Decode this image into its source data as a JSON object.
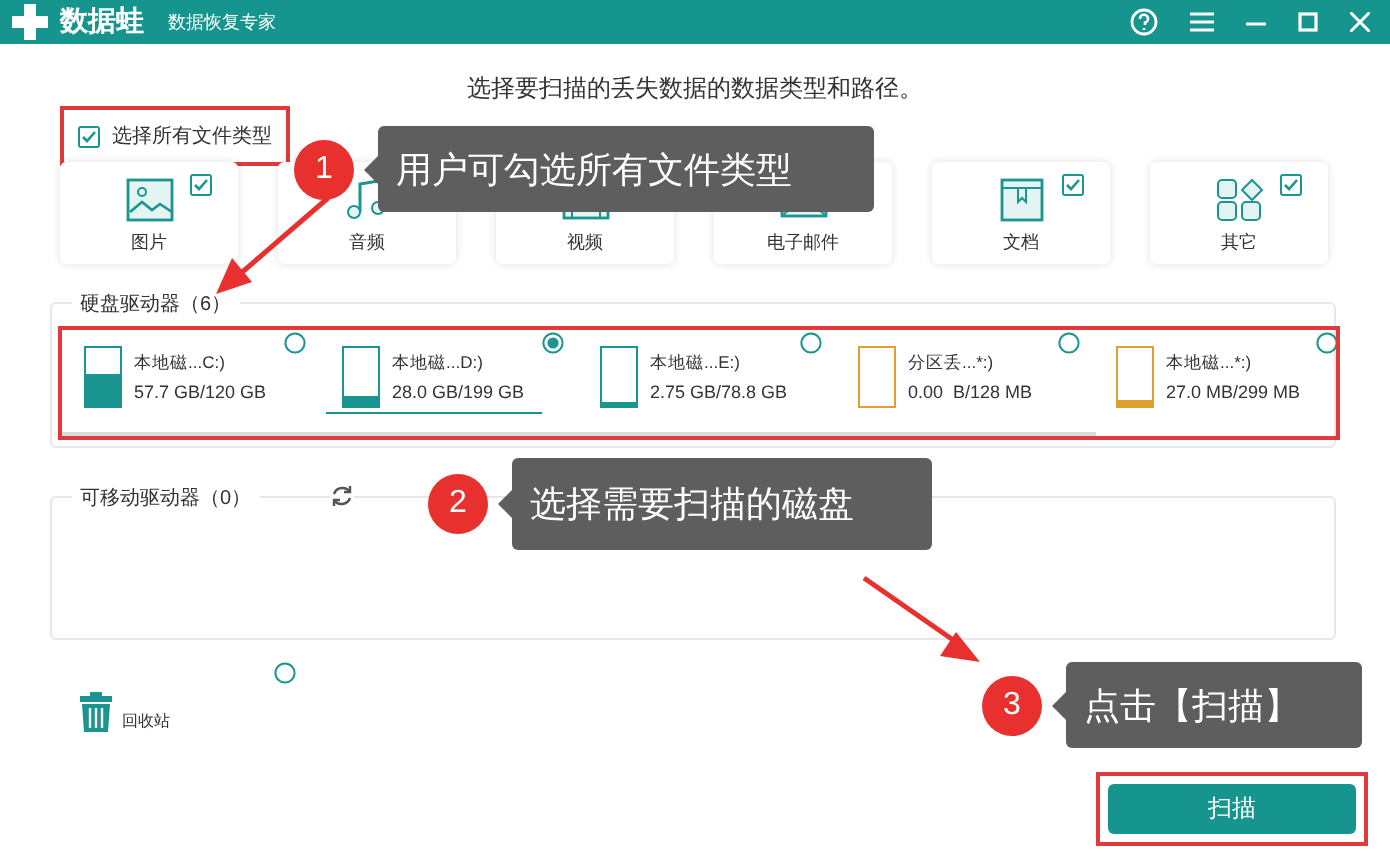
{
  "window": {
    "app_name": "数据蛙",
    "subtitle": "数据恢复专家"
  },
  "heading": "选择要扫描的丢失数据的数据类型和路径。",
  "select_all": {
    "label": "选择所有文件类型",
    "checked": true
  },
  "file_types": [
    {
      "kind": "image",
      "label": "图片",
      "checked": true
    },
    {
      "kind": "audio",
      "label": "音频"
    },
    {
      "kind": "video",
      "label": "视频"
    },
    {
      "kind": "email",
      "label": "电子邮件"
    },
    {
      "kind": "document",
      "label": "文档",
      "checked": true
    },
    {
      "kind": "other",
      "label": "其它",
      "checked": true
    }
  ],
  "hard_drives": {
    "title": "硬盘驱动器（6）",
    "drives": [
      {
        "name": "本地磁...C:)",
        "usage": "57.7 GB/120 GB",
        "level": 0.52,
        "color": "#1a9590",
        "selected": false
      },
      {
        "name": "本地磁...D:)",
        "usage": "28.0 GB/199 GB",
        "level": 0.14,
        "color": "#1a9590",
        "selected": true
      },
      {
        "name": "本地磁...E:)",
        "usage": "2.75 GB/78.8 GB",
        "level": 0.04,
        "color": "#1a9590",
        "selected": false
      },
      {
        "name": "分区丢...*:)",
        "usage": "0.00  B/128 MB",
        "level": 0,
        "color": "#e0a030",
        "selected": false
      },
      {
        "name": "本地磁...*:)",
        "usage": "27.0 MB/299 MB",
        "level": 0.09,
        "color": "#e0a030",
        "selected": false
      }
    ]
  },
  "removable_drives": {
    "title": "可移动驱动器（0）"
  },
  "stray_radio": {
    "selected": false
  },
  "recycle_bin": {
    "label": "回收站"
  },
  "scan_button": "扫描",
  "callouts": [
    {
      "number": "1",
      "text": "用户可勾选所有文件类型"
    },
    {
      "number": "2",
      "text": "选择需要扫描的磁盘"
    },
    {
      "number": "3",
      "text": "点击【扫描】"
    }
  ]
}
